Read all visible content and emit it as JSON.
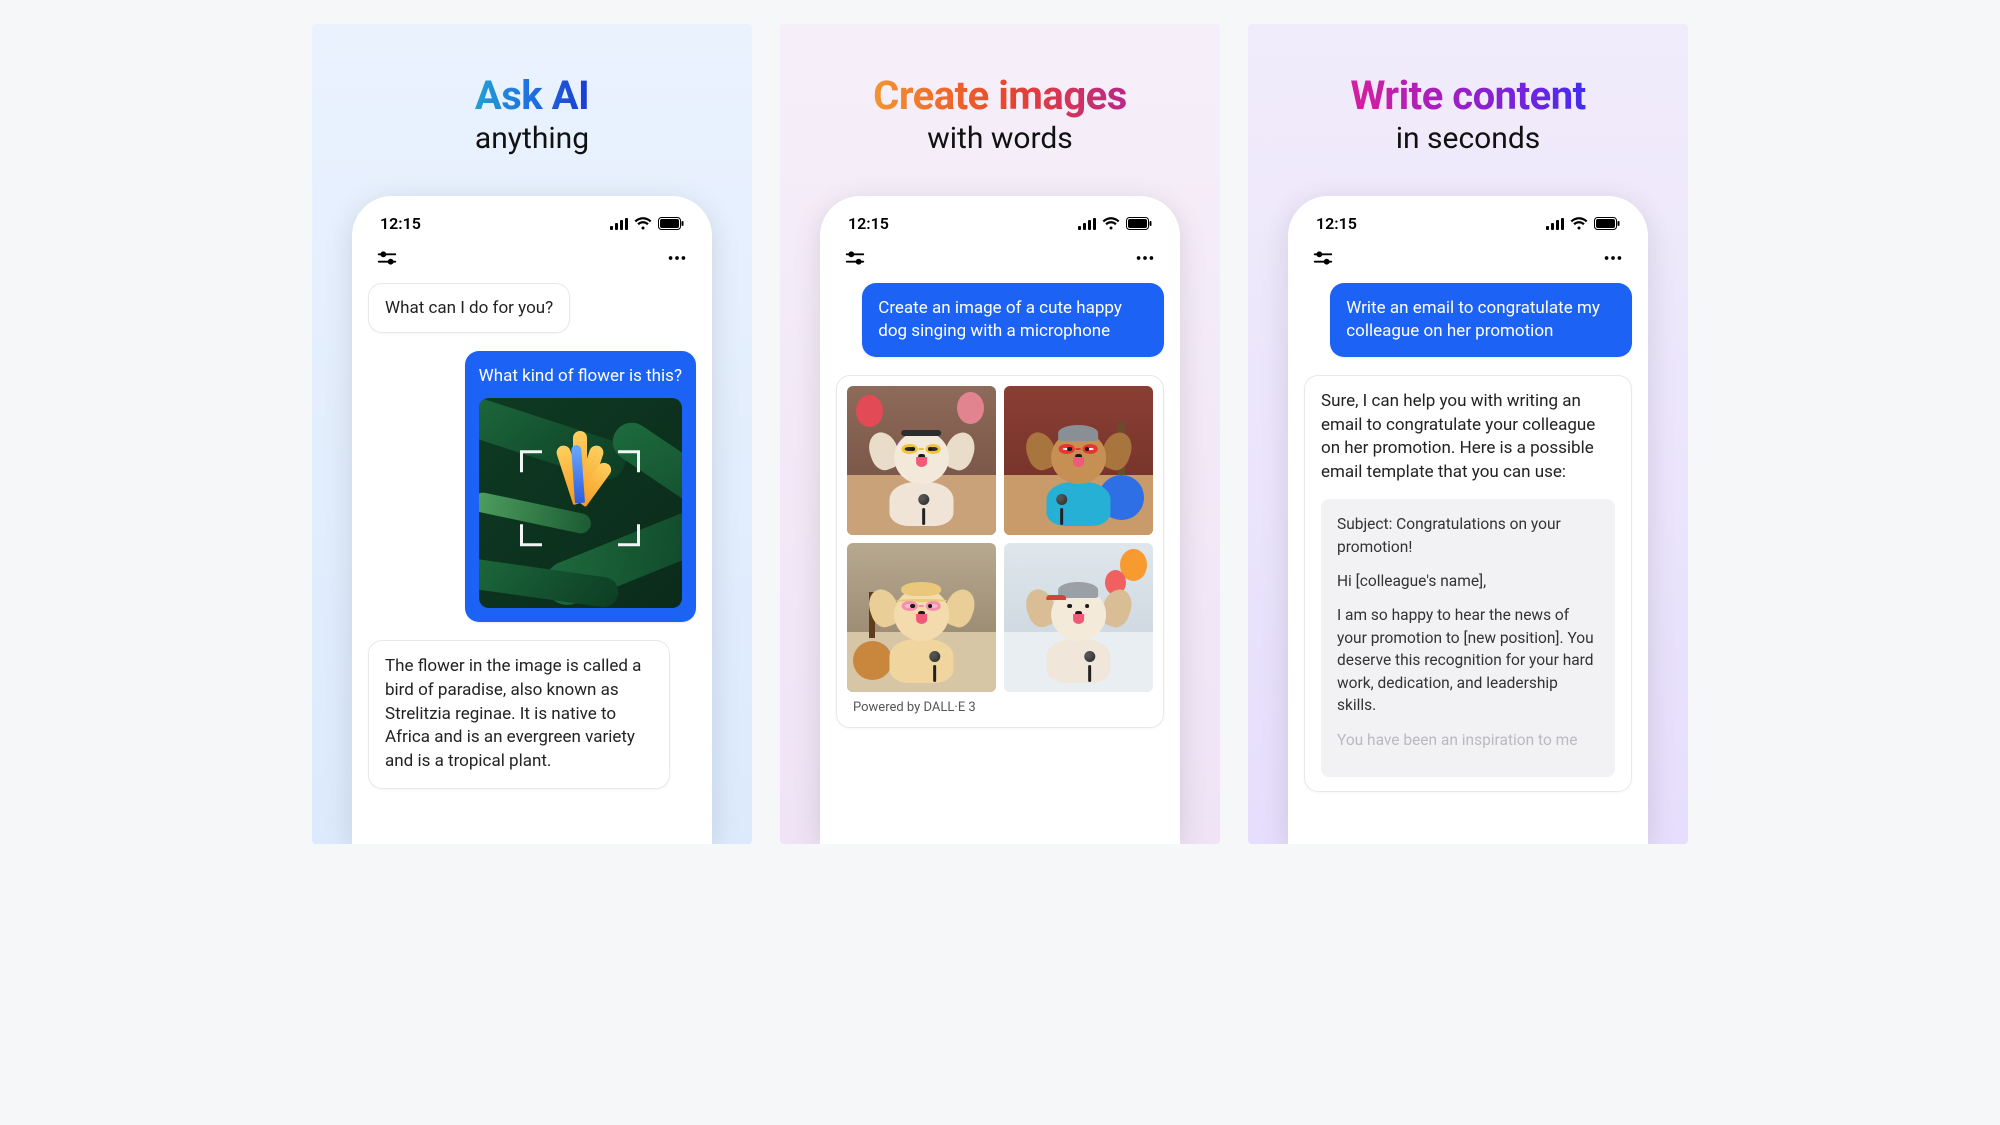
{
  "common": {
    "time": "12:15"
  },
  "panel1": {
    "headline": "Ask AI",
    "sub": "anything",
    "ai1": "What can I do for you?",
    "user1": "What kind of flower is this?",
    "ai2": "The flower in the image is called a bird of paradise, also known as Strelitzia reginae. It is native to Africa and is an evergreen variety and is a tropical plant."
  },
  "panel2": {
    "headline": "Create images",
    "sub": "with words",
    "user1": "Create an image of a cute happy dog singing with a microphone",
    "powered": "Powered by DALL·E 3"
  },
  "panel3": {
    "headline": "Write content",
    "sub": "in seconds",
    "user1": "Write an email to congratulate my colleague on her promotion",
    "ai_intro": "Sure, I can help you with writing an email to congratulate your colleague on her promotion. Here is a possible email template that you can use:",
    "email": {
      "subject": "Subject: Congratulations on your promotion!",
      "greeting": "Hi [colleague's name],",
      "body1": "I am so happy to hear the news of your promotion to [new position]. You deserve this recognition for your hard work, dedication, and leadership skills.",
      "body2": "You have been an inspiration to me"
    }
  }
}
